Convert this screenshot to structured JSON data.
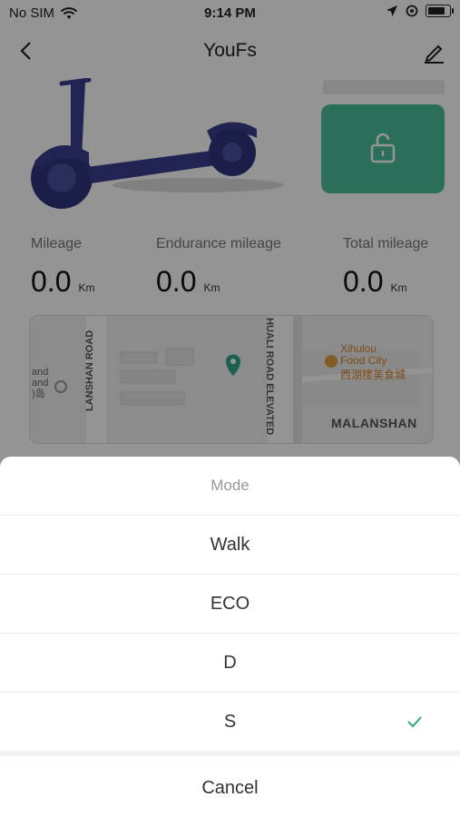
{
  "status": {
    "carrier": "No SIM",
    "time": "9:14 PM"
  },
  "nav": {
    "title": "YouFs"
  },
  "stats": [
    {
      "label": "Mileage",
      "value": "0.0",
      "unit": "Km"
    },
    {
      "label": "Endurance mileage",
      "value": "0.0",
      "unit": "Km"
    },
    {
      "label": "Total mileage",
      "value": "0.0",
      "unit": "Km"
    }
  ],
  "map": {
    "road_left": "LANSHAN ROAD",
    "road_right": "HUALI ROAD ELEVATED",
    "poi_en": "Xihulou Food City",
    "poi_cn": "西湖楼美食城",
    "district": "MALANSHAN",
    "left_text": "and\nand\n)岛"
  },
  "sheet": {
    "title": "Mode",
    "options": [
      "Walk",
      "ECO",
      "D",
      "S"
    ],
    "selected": "S",
    "cancel": "Cancel"
  },
  "colors": {
    "accent": "#4bbd9c",
    "check": "#2fa58a",
    "scooter": "#3a3f8f"
  }
}
